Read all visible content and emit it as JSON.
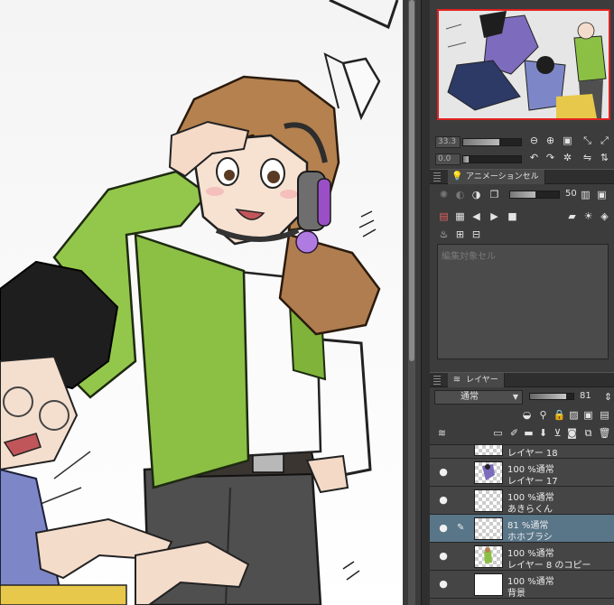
{
  "navigator": {
    "zoom": "33.3",
    "rotation": "0.0"
  },
  "animation_panel": {
    "tab_label": "アニメーションセル",
    "onion_value": "50",
    "empty_hint": "編集対象セル"
  },
  "layer_panel": {
    "tab_label": "レイヤー",
    "blend_mode": "通常",
    "opacity": "81",
    "layers": [
      {
        "mode": "",
        "name": "レイヤー 18",
        "partial": true
      },
      {
        "mode": "100 %通常",
        "name": "レイヤー 17"
      },
      {
        "mode": "100 %通常",
        "name": "あきらくん"
      },
      {
        "mode": "81 %通常",
        "name": "ホホブラシ",
        "selected": true
      },
      {
        "mode": "100 %通常",
        "name": "レイヤー 8 のコピー"
      },
      {
        "mode": "100 %通常",
        "name": "背景"
      }
    ]
  },
  "colors": {
    "selection": "#597588",
    "navigator_frame": "#e02020",
    "panel_bg": "#3c3c3c"
  }
}
